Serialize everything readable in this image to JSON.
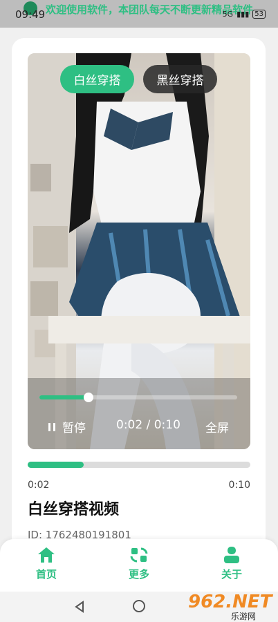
{
  "status": {
    "time": "09:49",
    "marquee": "欢迎使用软件，本团队每天不断更新精品软件",
    "network": "5G",
    "battery": "53"
  },
  "player": {
    "tabs": [
      {
        "label": "白丝穿搭",
        "active": true
      },
      {
        "label": "黑丝穿搭",
        "active": false
      }
    ],
    "pause_label": "暂停",
    "time_display": "0:02 / 0:10",
    "fullscreen_label": "全屏",
    "progress": 0.2
  },
  "info": {
    "current_time": "0:02",
    "total_time": "0:10",
    "title": "白丝穿搭视频",
    "id_text": "ID: 1762480191801"
  },
  "bottom_nav": [
    {
      "label": "首页",
      "icon": "home-icon"
    },
    {
      "label": "更多",
      "icon": "refresh-grid-icon"
    },
    {
      "label": "关于",
      "icon": "user-icon"
    }
  ],
  "watermark": {
    "main": "962.NET",
    "sub": "乐游网"
  },
  "colors": {
    "accent": "#2ebf83",
    "dark_pill": "#282828"
  }
}
